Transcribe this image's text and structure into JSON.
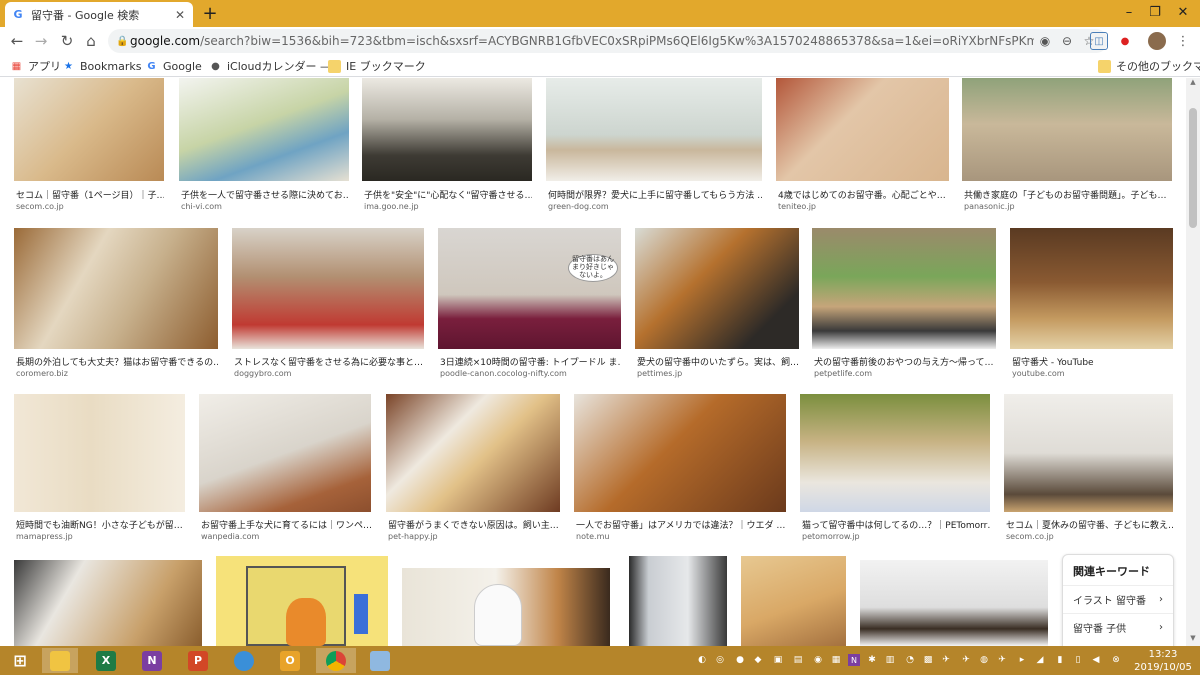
{
  "browser": {
    "tab": {
      "title": "留守番 - Google 検索",
      "favicon": "G"
    },
    "new_tab": "+",
    "window": {
      "minimize": "–",
      "maximize": "❐",
      "close": "✕"
    },
    "url": {
      "domain": "google.com",
      "rest": "/search?biw=1536&bih=723&tbm=isch&sxsrf=ACYBGNRB1GfbVEC0xSRpiPMs6QEl6Ig5Kw%3A1570248865378&sa=1&ei=oRiYXbrNFsPKmAXqnqy…"
    },
    "nav": {
      "back": "←",
      "forward": "→",
      "reload": "↻",
      "home": "⌂"
    },
    "bookmarks": [
      {
        "label": "アプリ",
        "icon": "apps-grid-icon"
      },
      {
        "label": "Bookmarks",
        "icon": "star-icon"
      },
      {
        "label": "Google",
        "icon": "google-icon"
      },
      {
        "label": "iCloudカレンダー —…",
        "icon": "apple-icon"
      },
      {
        "label": "IE ブックマーク",
        "icon": "folder-icon"
      }
    ],
    "other_bookmarks": "その他のブックマーク"
  },
  "results": {
    "rows": [
      [
        {
          "caption": "セコム｜留守番（1ページ目）｜子…",
          "source": "secom.co.jp"
        },
        {
          "caption": "子供を一人で留守番させる際に決めてお…",
          "source": "chi-vi.com"
        },
        {
          "caption": "子供を\"安全\"に\"心配なく\"留守番させる…",
          "source": "ima.goo.ne.jp"
        },
        {
          "caption": "何時間が限界？愛犬に上手に留守番してもらう方法 …",
          "source": "green-dog.com"
        },
        {
          "caption": "4歳ではじめてのお留守番。心配ごとや…",
          "source": "teniteo.jp"
        },
        {
          "caption": "共働き家庭の「子どものお留守番問題」。子ども…",
          "source": "panasonic.jp"
        }
      ],
      [
        {
          "caption": "長期の外泊しても大丈夫？猫はお留守番できるの…",
          "source": "coromero.biz"
        },
        {
          "caption": "ストレスなく留守番をさせる為に必要な事と…",
          "source": "doggybro.com"
        },
        {
          "caption": "3日連続×10時間の留守番: トイプードル ま…",
          "source": "poodle-canon.cocolog-nifty.com",
          "bubble": "留守番はあんまり好きじゃないよ。"
        },
        {
          "caption": "愛犬の留守番中のいたずら。実は、飼…",
          "source": "pettimes.jp"
        },
        {
          "caption": "犬の留守番前後のおやつの与え方〜帰って…",
          "source": "petpetlife.com"
        },
        {
          "caption": "留守番犬 - YouTube",
          "source": "youtube.com"
        }
      ],
      [
        {
          "caption": "短時間でも油断NG！小さな子どもが留…",
          "source": "mamapress.jp"
        },
        {
          "caption": "お留守番上手な犬に育てるには｜ワンペ…",
          "source": "wanpedia.com"
        },
        {
          "caption": "留守番がうまくできない原因は。飼い主…",
          "source": "pet-happy.jp"
        },
        {
          "caption": "一人でお留守番」はアメリカでは違法？｜ウエダ …",
          "source": "note.mu"
        },
        {
          "caption": "猫って留守番中は何してるの…？｜PETomorr…",
          "source": "petomorrow.jp"
        },
        {
          "caption": "セコム｜夏休みの留守番、子どもに教え…",
          "source": "secom.co.jp"
        }
      ]
    ]
  },
  "related": {
    "title": "関連キーワード",
    "items": [
      {
        "label": "イラスト 留守番",
        "arrow": "›"
      },
      {
        "label": "留守番 子供",
        "arrow": "›"
      }
    ]
  },
  "taskbar": {
    "apps": [
      {
        "icon": "windows-start-icon",
        "letter": ""
      },
      {
        "icon": "file-explorer-icon",
        "letter": ""
      },
      {
        "icon": "excel-icon",
        "letter": "X"
      },
      {
        "icon": "onenote-icon",
        "letter": "N"
      },
      {
        "icon": "powerpoint-icon",
        "letter": "P"
      },
      {
        "icon": "skype-icon",
        "letter": ""
      },
      {
        "icon": "outlook-icon",
        "letter": "O"
      },
      {
        "icon": "chrome-icon",
        "letter": ""
      },
      {
        "icon": "paint-icon",
        "letter": ""
      }
    ],
    "clock": {
      "time": "13:23",
      "date": "2019/10/05"
    }
  },
  "colors": {
    "tabstrip": "#e2a82c",
    "taskbar": "#b5852a",
    "link_source": "#666666"
  }
}
